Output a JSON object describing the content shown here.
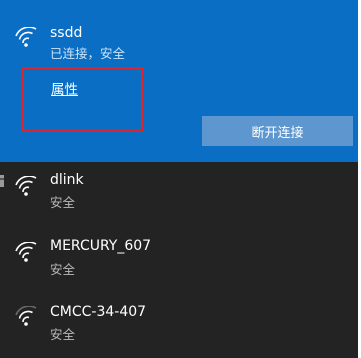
{
  "connected_network": {
    "ssid": "ssdd",
    "status": "已连接，安全",
    "properties_link": "属性",
    "disconnect_button": "断开连接",
    "background_color": "#0a6ec4",
    "icon": "wifi-signal-icon"
  },
  "networks": [
    {
      "ssid": "dlink",
      "security": "安全",
      "icon": "wifi-signal-icon"
    },
    {
      "ssid": "MERCURY_607",
      "security": "安全",
      "icon": "wifi-signal-icon"
    },
    {
      "ssid": "CMCC-34-407",
      "security": "安全",
      "icon": "wifi-signal-weak-icon"
    }
  ]
}
